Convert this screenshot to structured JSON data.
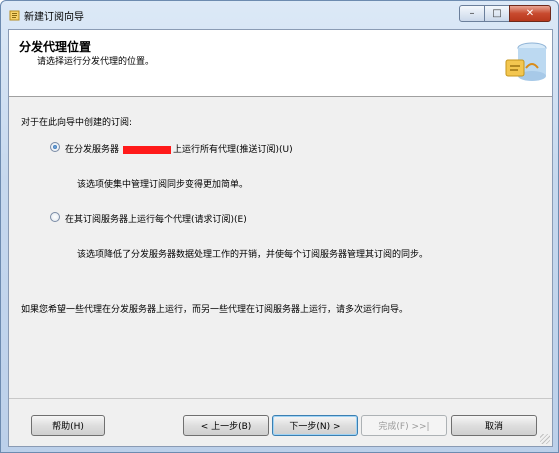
{
  "window": {
    "title": "新建订阅向导"
  },
  "header": {
    "title": "分发代理位置",
    "subtitle": "请选择运行分发代理的位置。"
  },
  "body": {
    "question": "对于在此向导中创建的订阅:",
    "option1": {
      "prefix": "在分发服务器",
      "suffix": "上运行所有代理(推送订阅)(U)",
      "selected": true,
      "description": "该选项使集中管理订阅同步变得更加简单。"
    },
    "option2": {
      "label": "在其订阅服务器上运行每个代理(请求订阅)(E)",
      "selected": false,
      "description": "该选项降低了分发服务器数据处理工作的开销，并使每个订阅服务器管理其订阅的同步。"
    },
    "note": "如果您希望一些代理在分发服务器上运行，而另一些代理在订阅服务器上运行，请多次运行向导。"
  },
  "buttons": {
    "help": "帮助(H)",
    "back": "< 上一步(B)",
    "next": "下一步(N) >",
    "finish": "完成(F) >>|",
    "cancel": "取消"
  },
  "caption": {
    "minimize": "–",
    "maximize": "□",
    "close": "✕"
  }
}
